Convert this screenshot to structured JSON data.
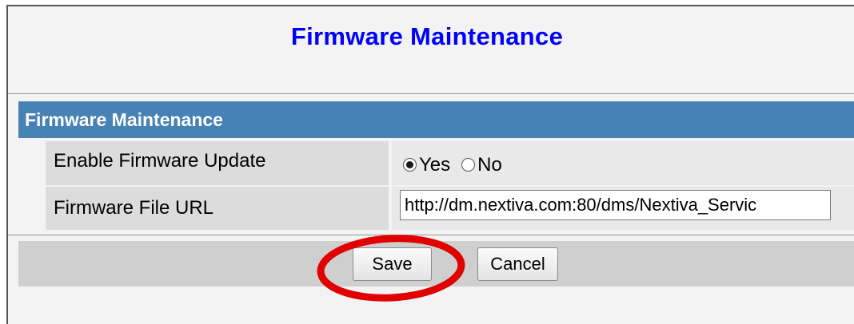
{
  "page": {
    "title": "Firmware Maintenance"
  },
  "section": {
    "header": "Firmware Maintenance",
    "rows": [
      {
        "label": "Enable Firmware Update",
        "type": "radio",
        "options": [
          "Yes",
          "No"
        ],
        "selected": "Yes"
      },
      {
        "label": "Firmware File URL",
        "type": "text",
        "value": "http://dm.nextiva.com:80/dms/Nextiva_Servic"
      }
    ]
  },
  "buttons": {
    "save_label": "Save",
    "cancel_label": "Cancel"
  },
  "colors": {
    "title": "#0000ff",
    "section_header_bg": "#4682b4",
    "highlight": "#e00000"
  },
  "annotation": {
    "type": "ellipse-highlight",
    "target": "save-button"
  }
}
